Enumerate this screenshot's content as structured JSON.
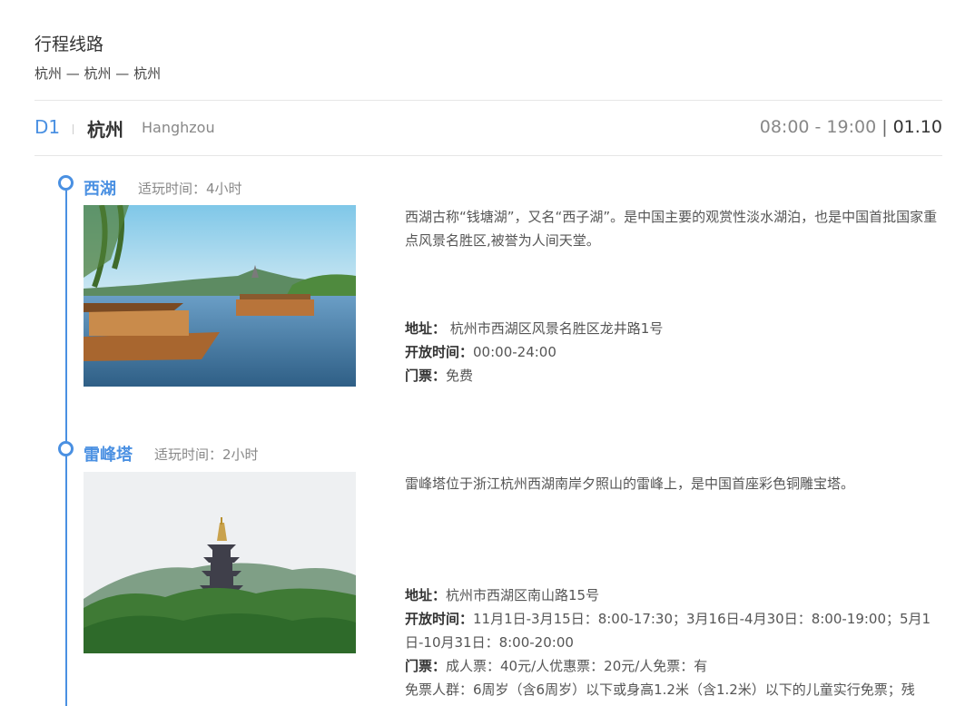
{
  "section": {
    "title": "行程线路",
    "route": "杭州 — 杭州 — 杭州"
  },
  "day": {
    "number": "D1",
    "city": "杭州",
    "city_en": "Hanghzou",
    "hours": "08:00 - 19:00",
    "separator": "|",
    "date": "01.10"
  },
  "spots": [
    {
      "name": "西湖",
      "duration": "适玩时间：4小时",
      "photo_icon": "west-lake-photo",
      "description": "西湖古称“钱塘湖”，又名“西子湖”。是中国主要的观赏性淡水湖泊，也是中国首批国家重点风景名胜区,被誉为人间天堂。",
      "address_label": "地址：",
      "address": " 杭州市西湖区风景名胜区龙井路1号",
      "hours_label": "开放时间：",
      "hours": "00:00-24:00",
      "ticket_label": "门票：",
      "ticket": "免费"
    },
    {
      "name": "雷峰塔",
      "duration": "适玩时间：2小时",
      "photo_icon": "leifeng-pagoda-photo",
      "description": "雷峰塔位于浙江杭州西湖南岸夕照山的雷峰上，是中国首座彩色铜雕宝塔。",
      "address_label": "地址：",
      "address": "杭州市西湖区南山路15号",
      "hours_label": "开放时间：",
      "hours": "11月1日-3月15日：8:00-17:30；3月16日-4月30日：8:00-19:00；5月1日-10月31日：8:00-20:00",
      "ticket_label": "门票：",
      "ticket": "成人票：40元/人优惠票：20元/人免票：有",
      "free_note": "免票人群：6周岁（含6周岁）以下或身高1.2米（含1.2米）以下的儿童实行免票；残"
    }
  ],
  "colors": {
    "accent": "#4a90e2",
    "text": "#333333",
    "muted": "#888888",
    "rule": "#e6e6e6"
  }
}
